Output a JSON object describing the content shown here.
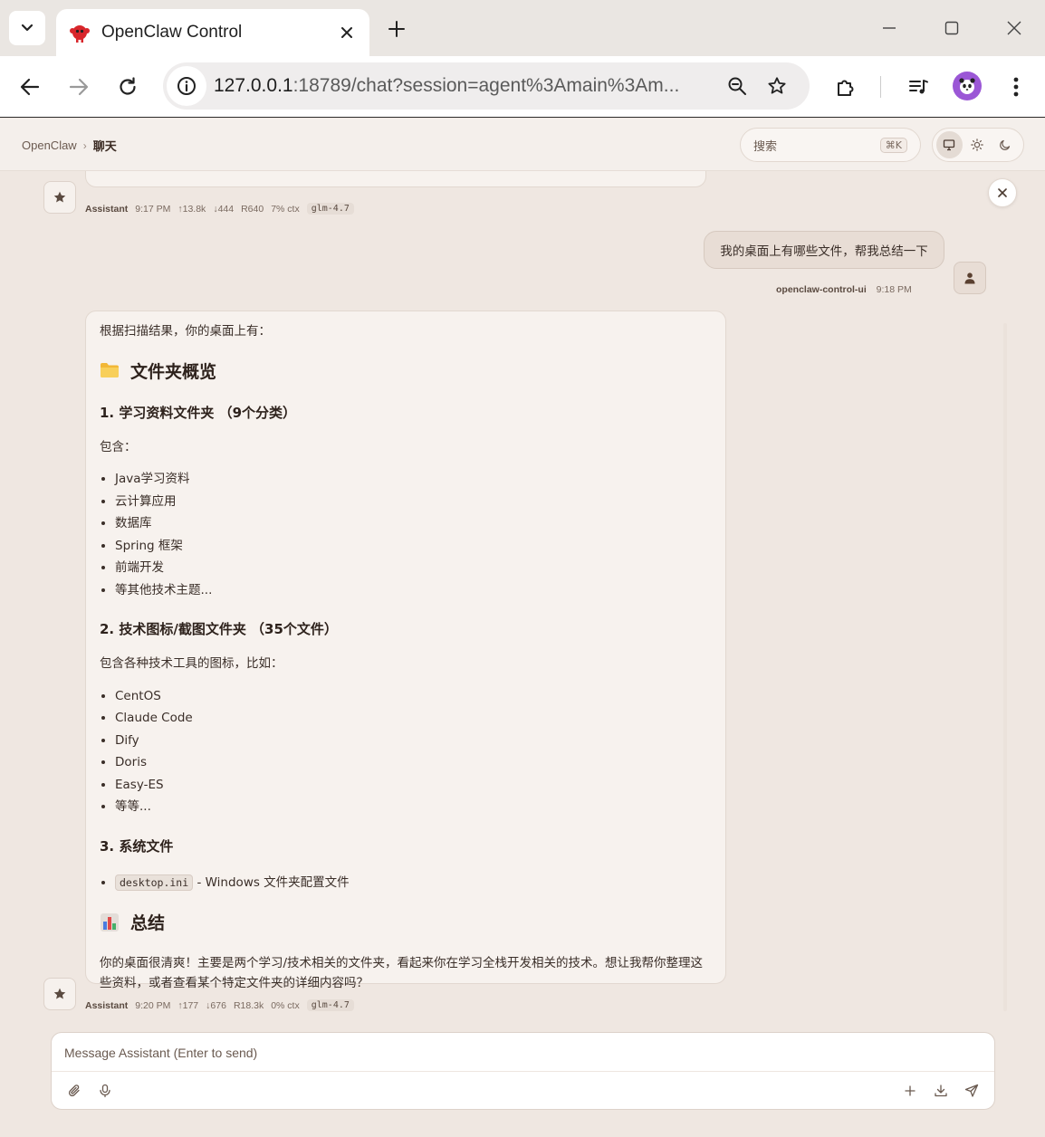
{
  "browser": {
    "tab_title": "OpenClaw Control",
    "url_host": "127.0.0.1",
    "url_rest": ":18789/chat?session=agent%3Amain%3Am...",
    "icons": [
      "tab-list-icon",
      "openclaw-favicon",
      "close-icon",
      "plus-icon",
      "minimize-icon",
      "maximize-icon",
      "window-close-icon",
      "back-icon",
      "forward-icon",
      "reload-icon",
      "site-info-icon",
      "zoom-icon",
      "star-icon",
      "extensions-icon",
      "media-icon",
      "profile-avatar",
      "menu-icon"
    ]
  },
  "header": {
    "breadcrumb_root": "OpenClaw",
    "breadcrumb_sep": "›",
    "breadcrumb_current": "聊天",
    "search_label": "搜索",
    "search_shortcut": "⌘K"
  },
  "messages": {
    "prev_meta": {
      "who": "Assistant",
      "time": "9:17 PM",
      "up": "↑13.8k",
      "down": "↓444",
      "r": "R640",
      "ctx": "7% ctx",
      "model": "glm-4.7"
    },
    "user": {
      "text": "我的桌面上有哪些文件，帮我总结一下",
      "who": "openclaw-control-ui",
      "time": "9:18 PM"
    },
    "reply": {
      "intro": "根据扫描结果，你的桌面上有：",
      "h_overview": "文件夹概览",
      "s1_title": "1. 学习资料文件夹 （9个分类）",
      "s1_lead": "包含：",
      "s1_items": [
        "Java学习资料",
        "云计算应用",
        "数据库",
        "Spring 框架",
        "前端开发",
        "等其他技术主题..."
      ],
      "s2_title": "2. 技术图标/截图文件夹 （35个文件）",
      "s2_lead": "包含各种技术工具的图标，比如：",
      "s2_items": [
        "CentOS",
        "Claude Code",
        "Dify",
        "Doris",
        "Easy-ES",
        "等等..."
      ],
      "s3_title": "3. 系统文件",
      "s3_code": "desktop.ini",
      "s3_text": " - Windows 文件夹配置文件",
      "h_summary": "总结",
      "summary": "你的桌面很清爽！主要是两个学习/技术相关的文件夹，看起来你在学习全栈开发相关的技术。想让我帮你整理这些资料，或者查看某个特定文件夹的详细内容吗？"
    },
    "reply_meta": {
      "who": "Assistant",
      "time": "9:20 PM",
      "up": "↑177",
      "down": "↓676",
      "r": "R18.3k",
      "ctx": "0% ctx",
      "model": "glm-4.7"
    }
  },
  "composer": {
    "placeholder": "Message Assistant (Enter to send)"
  },
  "colors": {
    "background": "#efe7e1",
    "bubble": "#f7f2ee",
    "user_bubble": "#e8ddd5",
    "text": "#3a2e28"
  }
}
